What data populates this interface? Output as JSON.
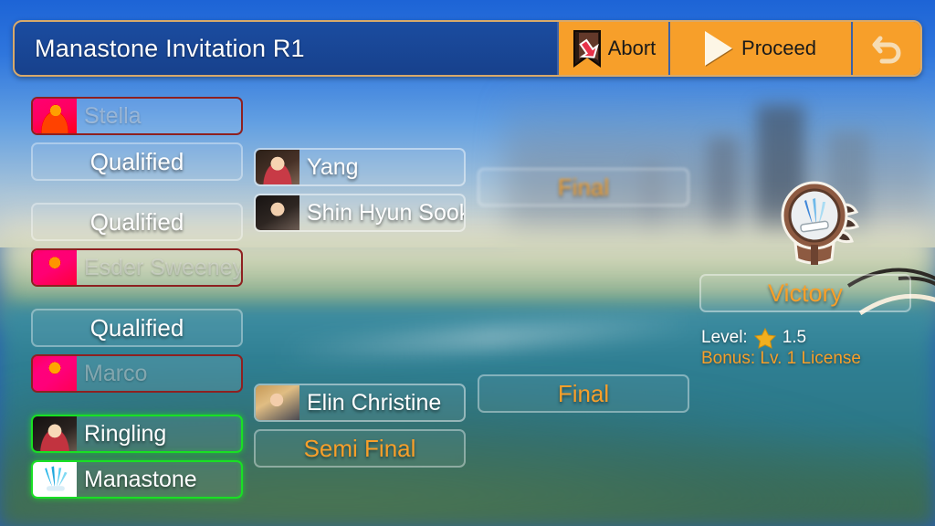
{
  "titlebar": {
    "title": "Manastone Invitation R1",
    "abort_label": "Abort",
    "proceed_label": "Proceed",
    "back_label": "",
    "accent_orange": "#f79f2a",
    "bar_blue": "#1b4ca0",
    "border_gold": "#d8a96a"
  },
  "bracket": {
    "round1": [
      {
        "name": "Stella",
        "status": "eliminated",
        "avatar": "av-stella"
      },
      {
        "name": "Qualified",
        "status": "ghost",
        "avatar": ""
      },
      {
        "name": "Qualified",
        "status": "ghost",
        "avatar": ""
      },
      {
        "name": "Esder Sweeney",
        "status": "eliminated",
        "avatar": "av-esder"
      },
      {
        "name": "Qualified",
        "status": "ghost",
        "avatar": ""
      },
      {
        "name": "Marco",
        "status": "eliminated",
        "avatar": "av-marco"
      },
      {
        "name": "Ringling",
        "status": "active",
        "avatar": "av-ringling"
      },
      {
        "name": "Manastone",
        "status": "active",
        "avatar": "av-manastone"
      }
    ],
    "round2": [
      {
        "name": "Yang",
        "status": "normal",
        "avatar": "av-yang"
      },
      {
        "name": "Shin Hyun Sook",
        "status": "normal",
        "avatar": "av-shin"
      },
      {
        "name": "Elin Christine",
        "status": "normal",
        "avatar": "av-elin"
      },
      {
        "name": "Semi Final",
        "status": "stage",
        "avatar": ""
      }
    ],
    "round3": [
      {
        "name": "Final",
        "status": "stage-blur",
        "avatar": ""
      },
      {
        "name": "Final",
        "status": "stage",
        "avatar": ""
      }
    ]
  },
  "reward": {
    "badge_icon": "trophy-medallion-icon",
    "outcome": "Victory",
    "level_label": "Level:",
    "level_value": "1.5",
    "star_icon": "star-icon",
    "bonus_label": "Bonus:",
    "bonus_value": "Lv. 1 License",
    "bonus_full": "Bonus: Lv. 1 License"
  },
  "colors": {
    "eliminated_border": "#8e2020",
    "active_border": "#19e024",
    "stage_text": "#f79f2a",
    "name_text": "#ffffff"
  }
}
